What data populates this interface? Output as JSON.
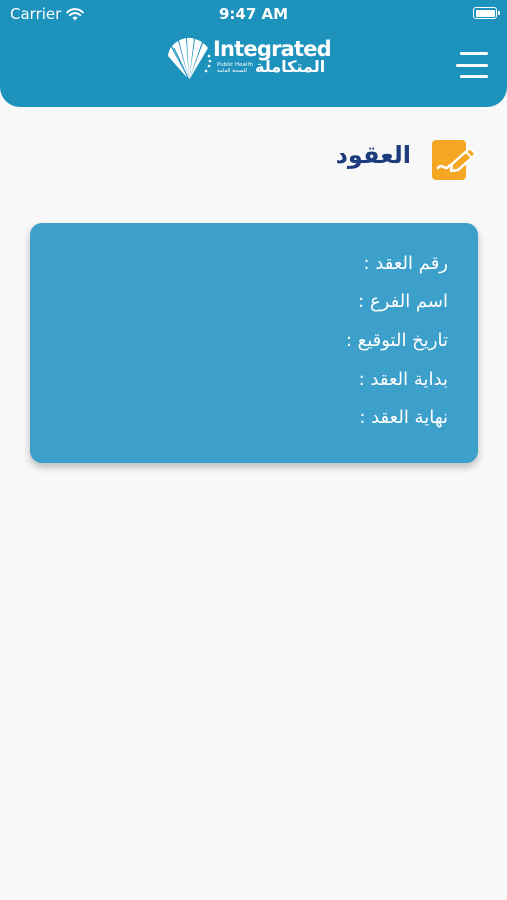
{
  "status_bar": {
    "carrier": "Carrier",
    "time": "9:47 AM",
    "wifi_icon": "wifi-icon",
    "battery_icon": "battery-icon"
  },
  "header": {
    "logo": {
      "en": "Integrated",
      "sub_line1": "Public Health",
      "sub_line2": "للصحة العامة",
      "ar": "المتكاملة"
    },
    "menu_icon": "hamburger-menu-icon",
    "background_color": "#1d92bd"
  },
  "page": {
    "title": "العقود",
    "title_icon": "contract-sign-icon",
    "title_color": "#1c3c7d",
    "icon_color": "#f5a623"
  },
  "contract_card": {
    "background_color": "#3da0cb",
    "fields": [
      {
        "label": "رقم العقد :"
      },
      {
        "label": "اسم الفرع :"
      },
      {
        "label": "تاريخ التوقيع :"
      },
      {
        "label": "بداية العقد :"
      },
      {
        "label": "نهاية العقد :"
      }
    ]
  }
}
